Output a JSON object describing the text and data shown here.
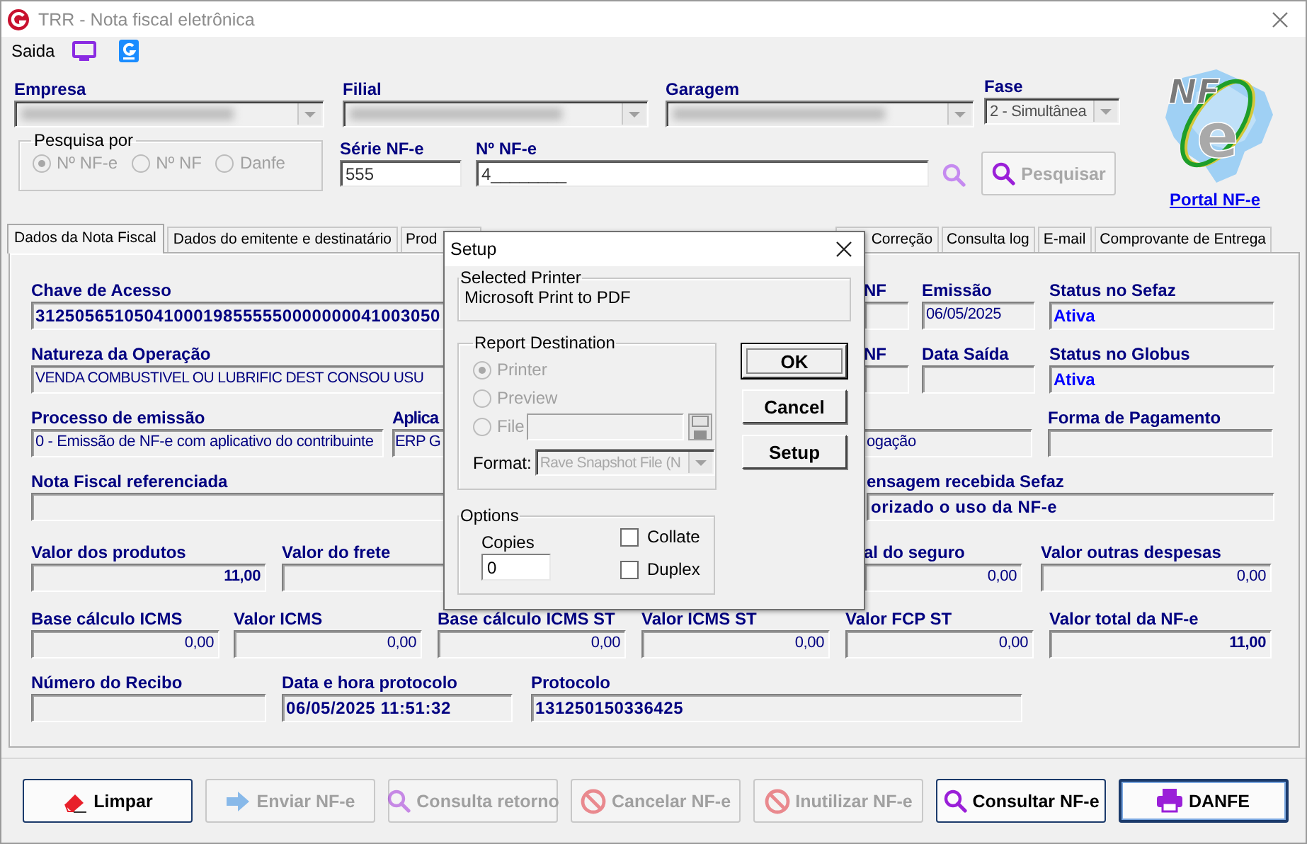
{
  "window": {
    "title": "TRR - Nota fiscal eletrônica"
  },
  "menu": {
    "label": "Saida"
  },
  "filters": [
    {
      "label": "Empresa",
      "redacted": true
    },
    {
      "label": "Filial",
      "redacted": true
    },
    {
      "label": "Garagem",
      "redacted": true
    },
    {
      "label": "Fase",
      "value": "2 - Simultânea",
      "redacted": false
    }
  ],
  "search_by": {
    "title": "Pesquisa por",
    "disabled": true,
    "options": [
      {
        "label": "Nº NF-e",
        "selected": true
      },
      {
        "label": "Nº NF",
        "selected": false
      },
      {
        "label": "Danfe",
        "selected": false
      }
    ]
  },
  "serie": {
    "label": "Série NF-e",
    "value": "555"
  },
  "numero": {
    "label": "Nº NF-e",
    "value": "4________"
  },
  "search_button": {
    "label": "Pesquisar",
    "disabled": true
  },
  "logo": {
    "text": "NF",
    "letter": "e",
    "link": "Portal NF-e"
  },
  "tabs": [
    {
      "label": "Dados da Nota Fiscal",
      "selected": true
    },
    {
      "label": "Dados do emitente e destinatário",
      "selected": false
    },
    {
      "label": "Prod",
      "selected": false
    },
    {
      "label": "Correção",
      "selected": false
    },
    {
      "label": "Consulta log",
      "selected": false
    },
    {
      "label": "E-mail",
      "selected": false
    },
    {
      "label": "Comprovante de Entrega",
      "selected": false
    }
  ],
  "rows": [
    {
      "fields": [
        {
          "label": "Chave de Acesso",
          "value": "31250565105041000198555550000000041003050",
          "kind": "text",
          "bold": true
        },
        {
          "label": "NF"
        },
        {
          "label": "Emissão",
          "value": "06/05/2025",
          "kind": "text",
          "bold": false
        },
        {
          "label": "Status no Sefaz",
          "value": "Ativa",
          "kind": "status",
          "bold": true
        }
      ]
    },
    {
      "fields": [
        {
          "label": "Natureza da Operação",
          "value": "VENDA COMBUSTIVEL OU LUBRIFIC DEST CONSOU USU",
          "kind": "text",
          "bold": false
        },
        {
          "label": "NF"
        },
        {
          "label": "Data Saída"
        },
        {
          "label": "Status no Globus",
          "value": "Ativa",
          "kind": "status",
          "bold": true
        }
      ]
    },
    {
      "fields": [
        {
          "label": "Processo de emissão",
          "value": "0 - Emissão de NF-e com aplicativo do contribuinte",
          "kind": "text",
          "bold": false
        },
        {
          "label": "Aplica",
          "value": "ERP G",
          "kind": "text",
          "bold": false
        },
        {
          "value": "ogação",
          "kind": "text",
          "bold": false
        },
        {
          "label": "Forma de Pagamento"
        }
      ]
    },
    {
      "fields": [
        {
          "label": "Nota Fiscal referenciada"
        },
        {
          "label": "ensagem recebida Sefaz",
          "value": "orizado o uso da NF-e",
          "kind": "text",
          "bold": true
        }
      ]
    },
    {
      "fields": [
        {
          "label": "Valor dos produtos",
          "value": "11,00",
          "kind": "amount",
          "bold": true
        },
        {
          "label": "Valor do frete"
        },
        {
          "label": "al do seguro",
          "value": "0,00",
          "kind": "amount",
          "bold": false
        },
        {
          "label": "Valor outras despesas",
          "value": "0,00",
          "kind": "amount",
          "bold": false
        }
      ]
    },
    {
      "fields": [
        {
          "label": "Base cálculo ICMS",
          "value": "0,00",
          "kind": "amount",
          "bold": false
        },
        {
          "label": "Valor ICMS",
          "value": "0,00",
          "kind": "amount",
          "bold": false
        },
        {
          "label": "Base cálculo ICMS ST",
          "value": "0,00",
          "kind": "amount",
          "bold": false
        },
        {
          "label": "Valor ICMS ST",
          "value": "0,00",
          "kind": "amount",
          "bold": false
        },
        {
          "label": "Valor FCP ST",
          "value": "0,00",
          "kind": "amount",
          "bold": false
        },
        {
          "label": "Valor total da NF-e",
          "value": "11,00",
          "kind": "amount",
          "bold": true
        }
      ]
    },
    {
      "fields": [
        {
          "label": "Número do Recibo"
        },
        {
          "label": "Data e hora protocolo",
          "value": "06/05/2025 11:51:32",
          "kind": "text",
          "bold": true
        },
        {
          "label": "Protocolo",
          "value": "131250150336425",
          "kind": "text",
          "bold": true
        }
      ]
    }
  ],
  "buttons": [
    {
      "label": "Limpar",
      "kind": "eraser",
      "disabled": false,
      "focused": false
    },
    {
      "label": "Enviar NF-e",
      "kind": "send",
      "disabled": true,
      "focused": false
    },
    {
      "label": "Consulta retorno",
      "kind": "status",
      "disabled": true,
      "focused": false
    },
    {
      "label": "Cancelar NF-e",
      "kind": "cancel",
      "disabled": true,
      "focused": false
    },
    {
      "label": "Inutilizar NF-e",
      "kind": "void",
      "disabled": true,
      "focused": false
    },
    {
      "label": "Consultar NF-e",
      "kind": "search",
      "disabled": false,
      "focused": false
    },
    {
      "label": "DANFE",
      "kind": "print",
      "disabled": false,
      "focused": true
    }
  ],
  "dialog": {
    "title": "Setup",
    "printer_group": "Selected Printer",
    "printer": "Microsoft Print to PDF",
    "destination": {
      "title": "Report Destination",
      "disabled": true,
      "options": [
        {
          "label": "Printer",
          "selected": true
        },
        {
          "label": "Preview",
          "selected": false
        },
        {
          "label": "File",
          "selected": false
        }
      ],
      "format_label": "Format:",
      "format_value": "Rave Snapshot File (N"
    },
    "options": {
      "title": "Options",
      "copies_label": "Copies",
      "copies": "0",
      "checks": [
        {
          "label": "Collate",
          "checked": false
        },
        {
          "label": "Duplex",
          "checked": false
        }
      ]
    },
    "buttons": [
      {
        "label": "OK",
        "default": true
      },
      {
        "label": "Cancel",
        "default": false
      },
      {
        "label": "Setup",
        "default": false
      }
    ]
  }
}
